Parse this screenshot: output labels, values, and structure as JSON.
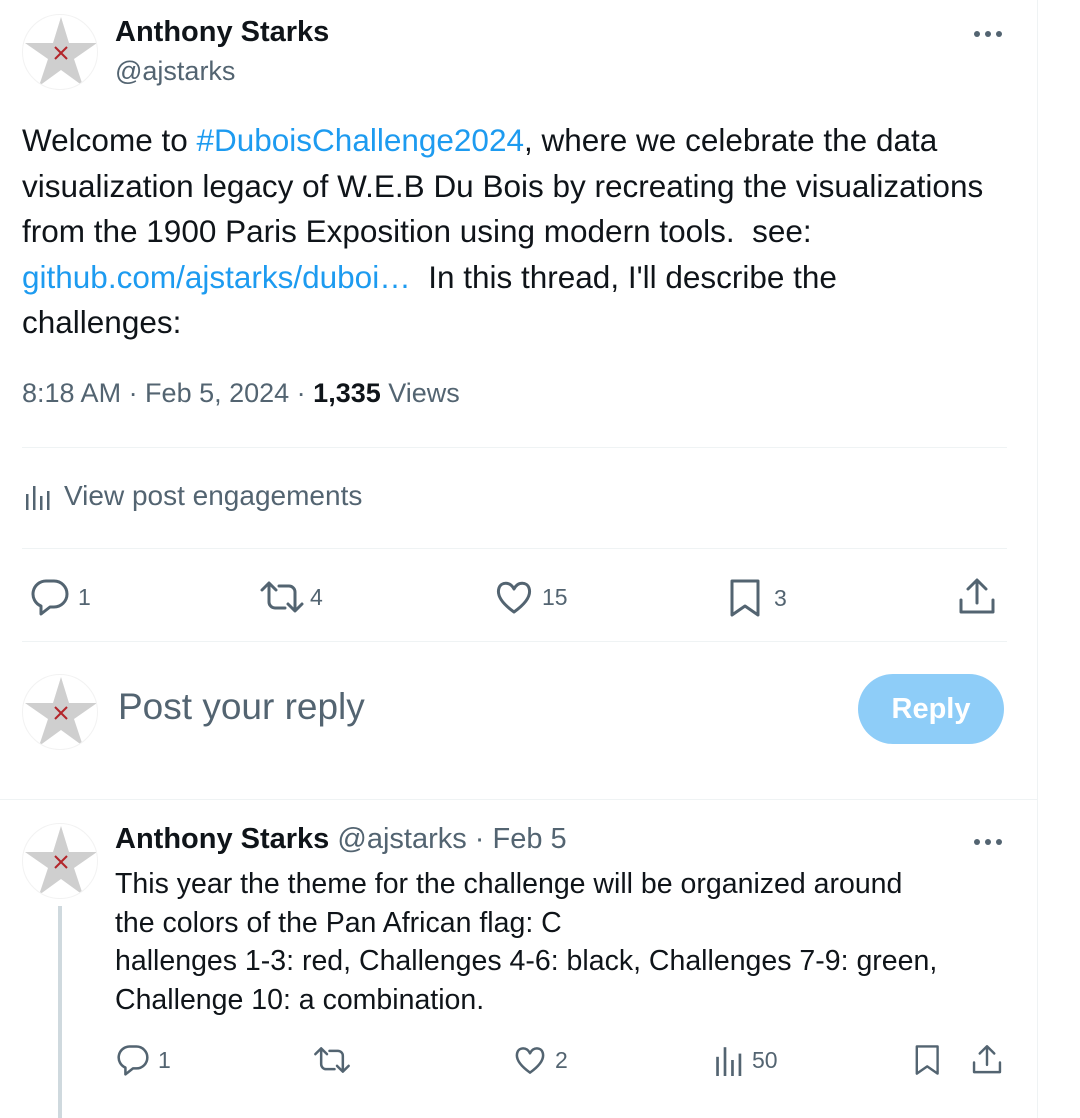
{
  "main_post": {
    "author_name": "Anthony Starks",
    "author_handle": "@ajstarks",
    "text_part1": "Welcome to ",
    "hashtag": "#DuboisChallenge2024",
    "text_part2": ", where we celebrate the data visualization legacy of W.E.B Du Bois by recreating the visualizations from the 1900 Paris Exposition using modern tools.  see: ",
    "link": "github.com/ajstarks/duboi…",
    "text_part3": "  In this thread, I'll describe the challenges:",
    "timestamp": "8:18 AM · Feb 5, 2024 · ",
    "views_count": "1,335",
    "views_label": " Views",
    "engagements_label": "View post engagements",
    "actions": {
      "replies": "1",
      "reposts": "4",
      "likes": "15",
      "bookmarks": "3"
    }
  },
  "reply_box": {
    "placeholder": "Post your reply",
    "button_label": "Reply",
    "button_color": "#8ecdf8"
  },
  "thread_post": {
    "author_name": "Anthony Starks",
    "handle_and_date": " @ajstarks · Feb 5",
    "lines": [
      "This year the theme for the challenge will be organized around",
      "the colors of the Pan African flag: C",
      "hallenges 1-3: red, Challenges 4-6: black, Challenges 7-9: green,",
      "Challenge 10: a combination."
    ],
    "actions": {
      "replies": "1",
      "likes": "2",
      "views": "50"
    }
  },
  "icons": {
    "avatar": "star-avatar-icon",
    "more": "more-dots-icon",
    "analytics": "analytics-icon",
    "reply": "reply-icon",
    "repost": "repost-icon",
    "like": "heart-icon",
    "bookmark": "bookmark-icon",
    "share": "share-icon"
  },
  "colors": {
    "link": "#1d9bf0",
    "secondary_text": "#536471",
    "primary_text": "#0f1419"
  }
}
